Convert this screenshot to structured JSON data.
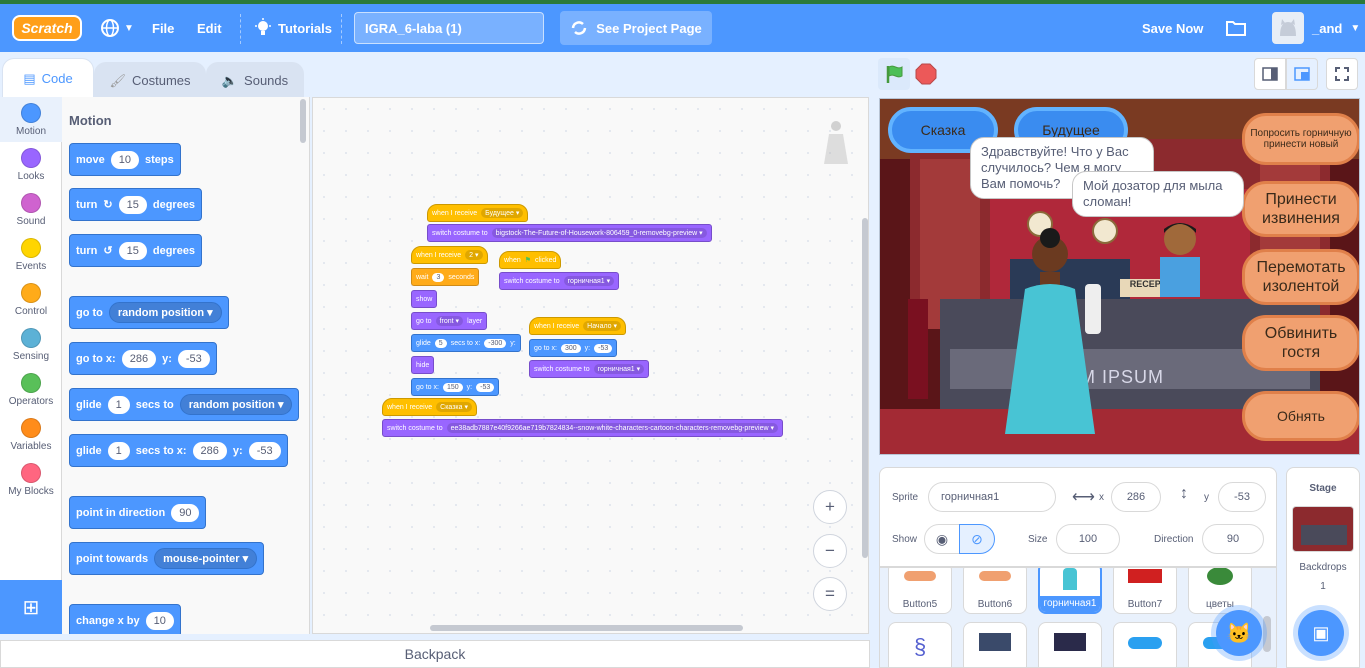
{
  "topbar": {
    "logo": "Scratch",
    "file": "File",
    "edit": "Edit",
    "tutorials": "Tutorials",
    "project_title": "IGRA_6-laba (1)",
    "see_project": "See Project Page",
    "save_now": "Save Now",
    "username": "_and"
  },
  "editor_tabs": {
    "code": "Code",
    "costumes": "Costumes",
    "sounds": "Sounds"
  },
  "categories": [
    {
      "label": "Motion",
      "color": "#4c97ff"
    },
    {
      "label": "Looks",
      "color": "#9966ff"
    },
    {
      "label": "Sound",
      "color": "#cf63cf"
    },
    {
      "label": "Events",
      "color": "#ffd500"
    },
    {
      "label": "Control",
      "color": "#ffab19"
    },
    {
      "label": "Sensing",
      "color": "#5cb1d6"
    },
    {
      "label": "Operators",
      "color": "#59c059"
    },
    {
      "label": "Variables",
      "color": "#ff8c1a"
    },
    {
      "label": "My Blocks",
      "color": "#ff6680"
    }
  ],
  "palette": {
    "heading": "Motion",
    "move": {
      "a": "move",
      "v": "10",
      "b": "steps"
    },
    "turn_right": {
      "a": "turn",
      "v": "15",
      "b": "degrees"
    },
    "turn_left": {
      "a": "turn",
      "v": "15",
      "b": "degrees"
    },
    "goto": {
      "a": "go to",
      "d": "random position"
    },
    "gotoxy": {
      "a": "go to x:",
      "x": "286",
      "yl": "y:",
      "y": "-53"
    },
    "glide": {
      "a": "glide",
      "v": "1",
      "b": "secs to",
      "d": "random position"
    },
    "glidexy": {
      "a": "glide",
      "v": "1",
      "b": "secs to x:",
      "x": "286",
      "yl": "y:",
      "y": "-53"
    },
    "point_dir": {
      "a": "point in direction",
      "v": "90"
    },
    "point_towards": {
      "a": "point towards",
      "d": "mouse-pointer"
    },
    "change_x": {
      "a": "change x by",
      "v": "10"
    }
  },
  "scripts": {
    "s1_hat": "when I receive",
    "s1_msg": "Будущее",
    "s1_costume": "switch costume to",
    "s1_costume_v": "bigstock-The-Future-of-Housework-806459_0-removebg-preview",
    "s2_hat": "when I receive",
    "s2_msg": "2",
    "wait": "wait",
    "wait_v": "3",
    "seconds": "seconds",
    "show": "show",
    "goto_layer": "go to",
    "layer_v": "front",
    "layer": "layer",
    "glide": "glide",
    "glide_v": "5",
    "glide_b": "secs to x:",
    "glide_x": "-300",
    "glide_y": "y:",
    "hide": "hide",
    "goto_x": "go to x:",
    "goto_xv": "150",
    "goto_y": "y:",
    "goto_yv": "-53",
    "flag_hat": "when",
    "flag_clicked": "clicked",
    "flag_costume": "switch costume to",
    "flag_costume_v": "горничная1",
    "s3_hat": "when I receive",
    "s3_msg": "Начало",
    "s3_goto": "go to x:",
    "s3_x": "300",
    "s3_yl": "y:",
    "s3_y": "-53",
    "s3_costume": "switch costume to",
    "s3_costume_v": "горничная1",
    "s4_hat": "when I receive",
    "s4_msg": "Сказка",
    "s4_costume": "switch costume to",
    "s4_costume_v": "ee38adb7887e40f9266ae719b7824834--snow-white-characters-cartoon-characters-removebg-preview"
  },
  "zoom": {
    "in": "+",
    "out": "−",
    "reset": "="
  },
  "backpack": "Backpack",
  "stage": {
    "btn_skazka": "Сказка",
    "btn_future": "Будущее",
    "btn_ask": "Попросить горничную принести новый",
    "btn_apologize": "Принести извинения",
    "btn_tape": "Перемотать изолентой",
    "btn_blame": "Обвинить гостя",
    "btn_hug": "Обнять",
    "bubble_maid": "Здравствуйте! Что у Вас случилось? Чем я могу Вам помочь?",
    "bubble_guest": "Мой дозатор для мыла сломан!",
    "sign_reception": "RECEPTION",
    "sign_ipsum": "M IPSUM"
  },
  "sprite_info": {
    "sprite_label": "Sprite",
    "sprite_name": "горничная1",
    "x_label": "x",
    "x": "286",
    "y_label": "y",
    "y": "-53",
    "show_label": "Show",
    "size_label": "Size",
    "size": "100",
    "direction_label": "Direction",
    "direction": "90"
  },
  "sprites": [
    "Button5",
    "Button6",
    "горничная1",
    "Button7",
    "цветы"
  ],
  "stage_pane": {
    "title": "Stage",
    "backdrops_label": "Backdrops",
    "backdrops_count": "1"
  },
  "colors": {
    "accent": "#4c97ff",
    "events": "#ffbf00",
    "looks": "#9966ff"
  }
}
